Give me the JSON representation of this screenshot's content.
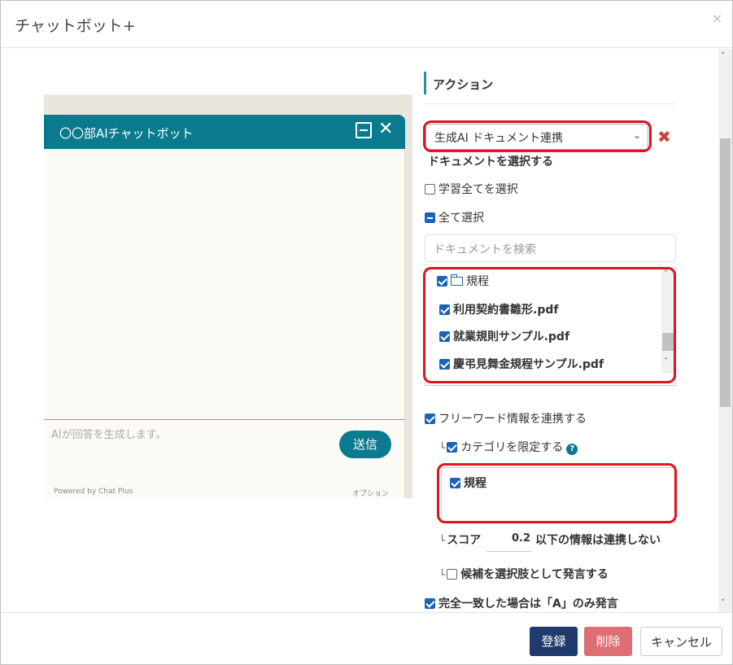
{
  "window": {
    "title": "チャットボット+",
    "close_glyph": "×"
  },
  "preview": {
    "header_title": "〇〇部AIチャットボット",
    "input_placeholder": "AIが回答を生成します。",
    "send_label": "送信",
    "powered_by": "Powered by Chat Plus",
    "option_label": "オプション"
  },
  "action": {
    "section_title": "アクション",
    "selected_action": "生成AI ドキュメント連携",
    "select_doc_label": "ドキュメントを選択する",
    "learn_all_label": "学習全てを選択",
    "select_all_label": "全て選択",
    "search_placeholder": "ドキュメントを検索",
    "folder": "規程",
    "documents": [
      "利用契約書雛形.pdf",
      "就業規則サンプル.pdf",
      "慶弔見舞金規程サンプル.pdf"
    ],
    "freeword_label": "フリーワード情報を連携する",
    "category_label": "カテゴリを限定する",
    "category_items": [
      "規程"
    ],
    "score_prefix": "スコア",
    "score_value": "0.2",
    "score_suffix": "以下の情報は連携しない",
    "candidates_label": "候補を選択肢として発言する",
    "exact_match_label": "完全一致した場合は「A」のみ発言",
    "tree_prefix": "└"
  },
  "footer": {
    "register": "登録",
    "delete": "削除",
    "cancel": "キャンセル"
  },
  "colors": {
    "accent": "#0a7a8f",
    "checkbox": "#1a63b8",
    "highlight": "#e0141e",
    "register": "#213a6e",
    "delete": "#dd6e74"
  }
}
